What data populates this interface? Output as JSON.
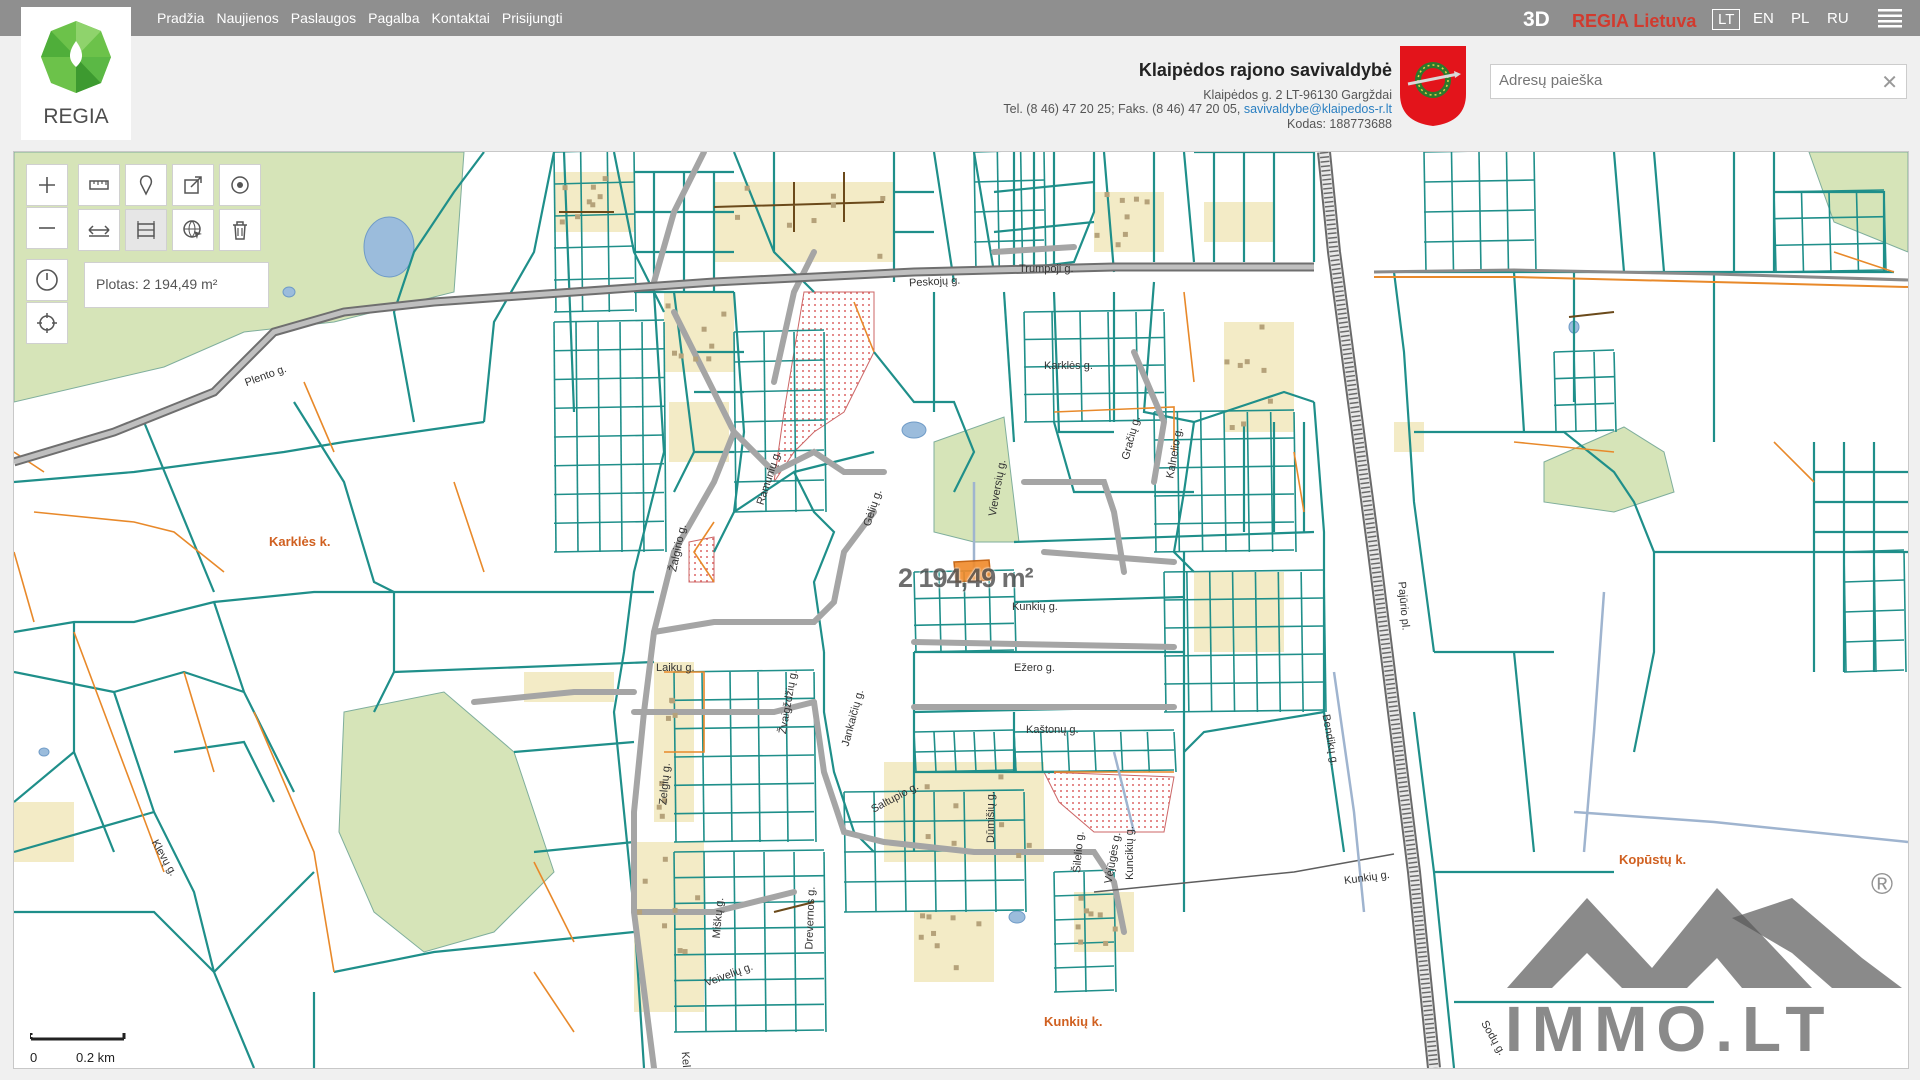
{
  "app": {
    "logo_text": "REGIA",
    "nav": [
      "Pradžia",
      "Naujienos",
      "Paslaugos",
      "Pagalba",
      "Kontaktai",
      "Prisijungti"
    ],
    "btn_3d": "3D",
    "region": "REGIA Lietuva",
    "languages": [
      "LT",
      "EN",
      "PL",
      "RU"
    ],
    "active_language": "LT",
    "menu_icon": "hamburger-menu-icon"
  },
  "organization": {
    "title": "Klaipėdos rajono savivaldybė",
    "address": "Klaipėdos g. 2 LT-96130 Gargždai",
    "contact_prefix": "Tel. (8 46) 47 20 25; Faks. (8 46) 47 20 05,",
    "email": "savivaldybe@klaipedos-r.lt",
    "code": "Kodas: 188773688",
    "coat_of_arms_icon": "coat-of-arms-icon"
  },
  "search": {
    "placeholder": "Adresų paieška",
    "value": "",
    "clear_icon": "close-icon"
  },
  "map_tools": {
    "zoom_in_icon": "plus-icon",
    "zoom_out_icon": "minus-icon",
    "history_icon": "clock-icon",
    "locate_icon": "crosshair-icon",
    "tools": [
      "ruler-icon",
      "marker-icon",
      "share-icon",
      "target-icon",
      "measure-distance-icon",
      "measure-area-icon",
      "globe-cursor-icon",
      "trash-icon"
    ],
    "area_label": "Plotas: 2 194,49 m²"
  },
  "map": {
    "measured_area_label": "2 194,49 m²",
    "streets": [
      "Peskojų g.",
      "Plento g.",
      "Trumpoji g.",
      "Žalgirio g.",
      "Ramunių g.",
      "Gėlių g.",
      "Vieversių g.",
      "Kalnelio g.",
      "Gračių g.",
      "Kunkių g.",
      "Ežero g.",
      "Kaštonų g.",
      "Laiku g.",
      "Žvaigždžių g.",
      "Jankaičių g.",
      "Saltupio g.",
      "Zelgių g.",
      "Miškų g.",
      "Dūmišių g.",
      "Šilelio g.",
      "Kuncikių g.",
      "Kunkių g.",
      "Bendikų g.",
      "Pajūrio pl.",
      "Veivelių g.",
      "Kelio g.",
      "Klevų g.",
      "Vėjūgės g.",
      "Drevernos g.",
      "Karklės g.",
      "Sodų g."
    ],
    "villages": [
      "Karklės k.",
      "Kopūstų k.",
      "Kunkių k."
    ],
    "scale": {
      "zero": "0",
      "distance": "0.2 km"
    }
  },
  "colors": {
    "topbar": "#8f8f8f",
    "brand_green": "#5cb85c",
    "region_red": "#d23a2e",
    "parcel": "#1f8f8a",
    "parcel_orange": "#e8892a",
    "road_gray": "#a0a0a0",
    "forest_green": "#d6e4b8",
    "building_tan": "#f3ebc6",
    "water_blue": "#9bbcdc"
  },
  "watermark": {
    "text": "IMMO.LT",
    "registered": "®"
  }
}
